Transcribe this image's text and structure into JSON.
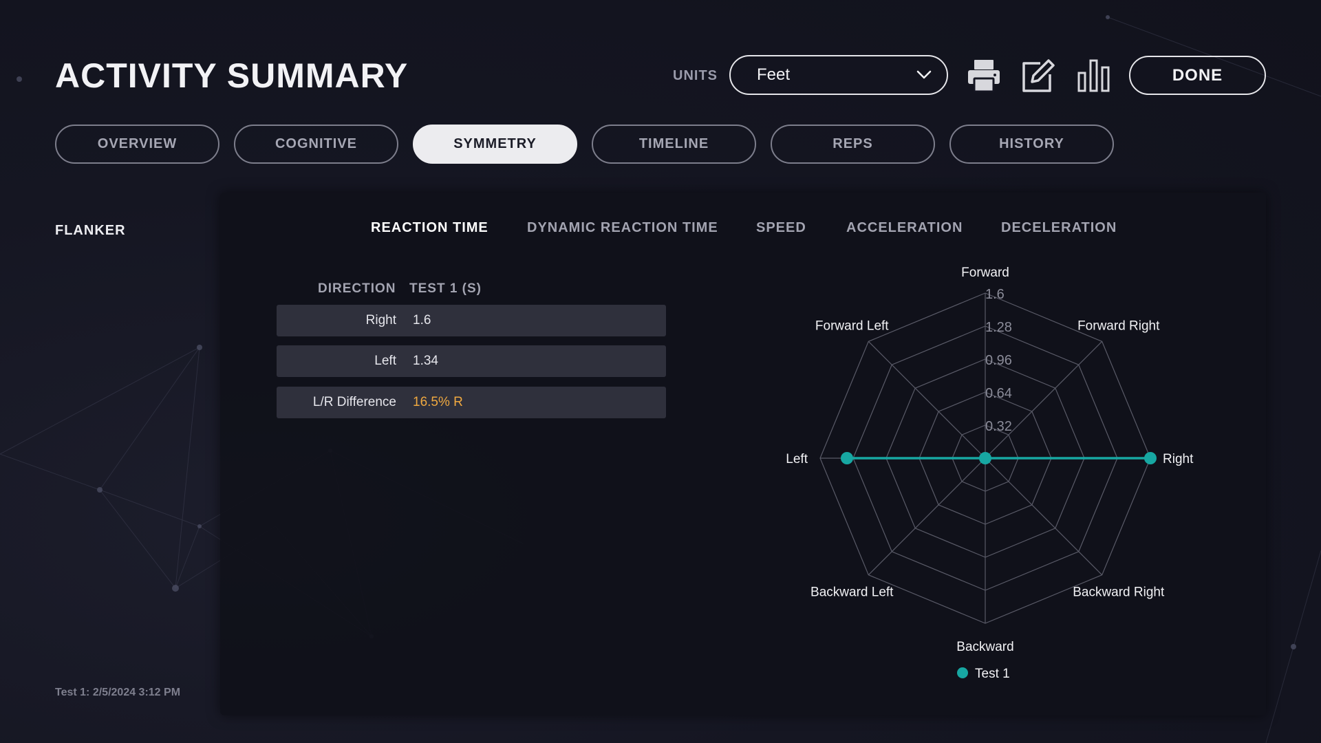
{
  "header": {
    "title": "ACTIVITY SUMMARY",
    "units_label": "UNITS",
    "units_value": "Feet",
    "done_label": "DONE",
    "icons": [
      "print-icon",
      "edit-icon",
      "bar-chart-icon"
    ]
  },
  "tabs": [
    {
      "label": "OVERVIEW",
      "active": false
    },
    {
      "label": "COGNITIVE",
      "active": false
    },
    {
      "label": "SYMMETRY",
      "active": true
    },
    {
      "label": "TIMELINE",
      "active": false
    },
    {
      "label": "REPS",
      "active": false
    },
    {
      "label": "HISTORY",
      "active": false
    }
  ],
  "sidebar": {
    "activity": "FLANKER",
    "test_stamp": "Test 1: 2/5/2024 3:12 PM"
  },
  "metric_tabs": [
    {
      "label": "REACTION TIME",
      "active": true
    },
    {
      "label": "DYNAMIC REACTION TIME",
      "active": false
    },
    {
      "label": "SPEED",
      "active": false
    },
    {
      "label": "ACCELERATION",
      "active": false
    },
    {
      "label": "DECELERATION",
      "active": false
    }
  ],
  "table": {
    "headers": [
      "DIRECTION",
      "TEST 1 (S)"
    ],
    "rows": [
      {
        "direction": "Right",
        "value": "1.6"
      },
      {
        "direction": "Left",
        "value": "1.34"
      },
      {
        "direction": "L/R Difference",
        "value": "16.5% R"
      }
    ]
  },
  "colors": {
    "accent": "#17a7a2",
    "difference": "#f0a940",
    "active_tab_bg": "#ececef"
  },
  "chart_data": {
    "type": "radar",
    "axes": [
      "Forward",
      "Forward Right",
      "Right",
      "Backward Right",
      "Backward",
      "Backward Left",
      "Left",
      "Forward Left"
    ],
    "ticks": [
      0.32,
      0.64,
      0.96,
      1.28,
      1.6
    ],
    "range": [
      0,
      1.6
    ],
    "series": [
      {
        "name": "Test 1",
        "values": [
          0,
          0,
          1.6,
          0,
          0,
          0,
          1.34,
          0
        ],
        "color": "#17a7a2"
      }
    ],
    "legend": "bottom"
  }
}
